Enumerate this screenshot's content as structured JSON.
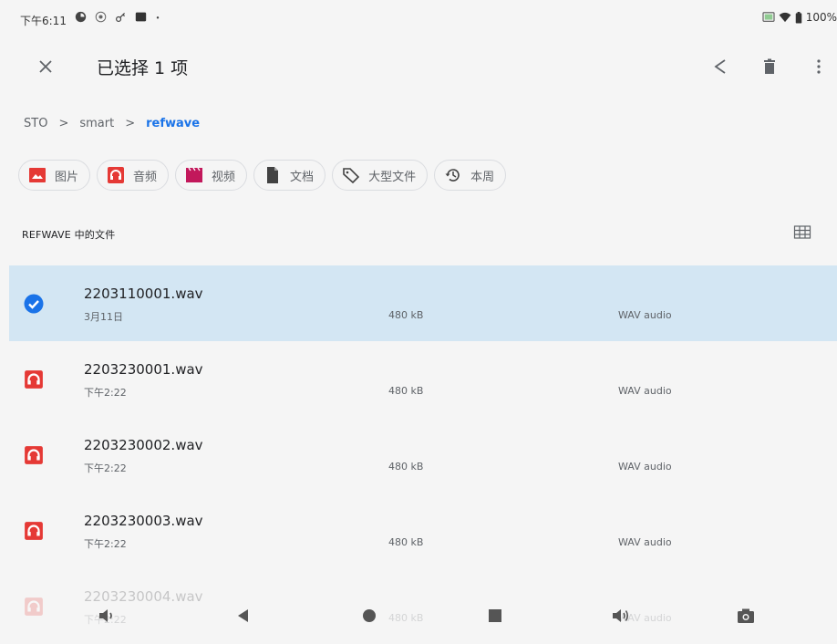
{
  "status_bar": {
    "time": "下午6:11",
    "battery_text": "100%",
    "left_icons": [
      "sync-icon",
      "location-icon",
      "key-icon",
      "card-icon",
      "dot-icon"
    ],
    "right_icons": [
      "cast-icon",
      "wifi-icon",
      "battery-icon"
    ]
  },
  "app_bar": {
    "title": "已选择 1 项",
    "close_icon": "close-icon",
    "action_icons": [
      "share-icon",
      "delete-icon",
      "more-vert-icon"
    ]
  },
  "breadcrumb": {
    "items": [
      "STO",
      "smart",
      "refwave"
    ],
    "separator": ">"
  },
  "chips": [
    {
      "label": "图片",
      "icon": "image-icon",
      "color": "#e53935"
    },
    {
      "label": "音频",
      "icon": "headphones-icon",
      "color": "#e53935"
    },
    {
      "label": "视频",
      "icon": "movie-icon",
      "color": "#c2185b"
    },
    {
      "label": "文档",
      "icon": "document-icon",
      "color": "#424242"
    },
    {
      "label": "大型文件",
      "icon": "tag-icon",
      "color": "#424242"
    },
    {
      "label": "本周",
      "icon": "history-icon",
      "color": "#424242"
    }
  ],
  "section": {
    "title": "REFWAVE 中的文件",
    "view_toggle_icon": "grid-view-icon"
  },
  "files": [
    {
      "name": "2203110001.wav",
      "date": "3月11日",
      "size": "480 kB",
      "type": "WAV audio",
      "selected": true
    },
    {
      "name": "2203230001.wav",
      "date": "下午2:22",
      "size": "480 kB",
      "type": "WAV audio",
      "selected": false
    },
    {
      "name": "2203230002.wav",
      "date": "下午2:22",
      "size": "480 kB",
      "type": "WAV audio",
      "selected": false
    },
    {
      "name": "2203230003.wav",
      "date": "下午2:22",
      "size": "480 kB",
      "type": "WAV audio",
      "selected": false
    },
    {
      "name": "2203230004.wav",
      "date": "下午2:22",
      "size": "480 kB",
      "type": "WAV audio",
      "selected": false
    }
  ],
  "nav_bar": {
    "icons": [
      "volume-down-icon",
      "back-icon",
      "home-icon",
      "recents-icon",
      "volume-up-icon",
      "screenshot-icon"
    ]
  },
  "colors": {
    "accent": "#1a73e8",
    "selected_row": "#d3e6f3",
    "audio_icon": "#e53935",
    "background": "#f5f5f5"
  }
}
